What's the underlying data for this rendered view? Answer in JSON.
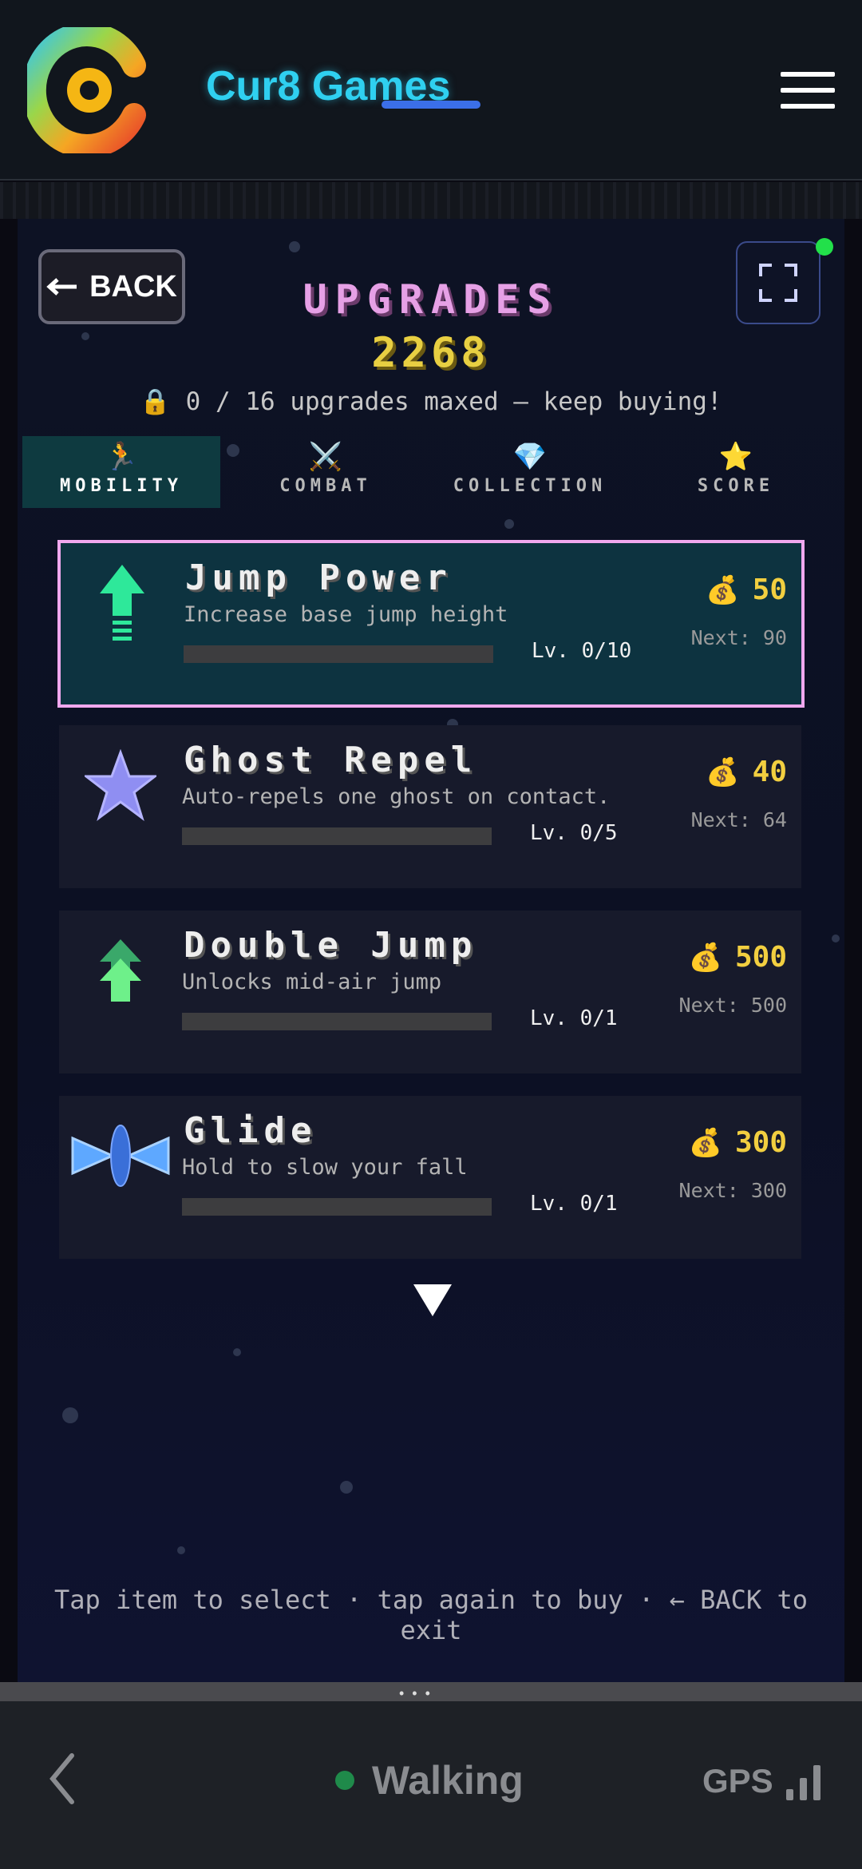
{
  "site": {
    "brand": "Cur8 Games",
    "colors": {
      "brand": "#2fd0f0",
      "underline": "#3b6fe8"
    }
  },
  "game": {
    "back_label": "BACK",
    "title": "UPGRADES",
    "coins": "2268",
    "status": "🔒 0 / 16 upgrades maxed — keep buying!",
    "tabs": [
      {
        "label": "MOBILITY",
        "icon": "🏃",
        "active": true
      },
      {
        "label": "COMBAT",
        "icon": "⚔️",
        "active": false
      },
      {
        "label": "COLLECTION",
        "icon": "💎",
        "active": false
      },
      {
        "label": "SCORE",
        "icon": "⭐",
        "active": false
      }
    ],
    "upgrades": [
      {
        "name": "Jump Power",
        "desc": "Increase base jump height",
        "level": "Lv. 0/10",
        "progress": 0,
        "price": "50",
        "next": "Next: 90",
        "icon": "up-arrow-icon",
        "selected": true
      },
      {
        "name": "Ghost Repel",
        "desc": "Auto-repels one ghost on contact.",
        "level": "Lv. 0/5",
        "progress": 0,
        "price": "40",
        "next": "Next: 64",
        "icon": "star-icon",
        "selected": false
      },
      {
        "name": "Double Jump",
        "desc": "Unlocks mid-air jump",
        "level": "Lv. 0/1",
        "progress": 0,
        "price": "500",
        "next": "Next: 500",
        "icon": "double-arrow-icon",
        "selected": false
      },
      {
        "name": "Glide",
        "desc": "Hold to slow your fall",
        "level": "Lv. 0/1",
        "progress": 0,
        "price": "300",
        "next": "Next: 300",
        "icon": "glider-icon",
        "selected": false
      }
    ],
    "hint": "Tap item to select · tap again to buy · ← BACK to exit",
    "colors": {
      "title": "#e6a0e6",
      "coins": "#e8cf42",
      "selected_border": "#f0a8ee",
      "selected_bg": "#0d3340"
    }
  },
  "browser_bar": {
    "mode": "Walking",
    "gps": "GPS"
  }
}
